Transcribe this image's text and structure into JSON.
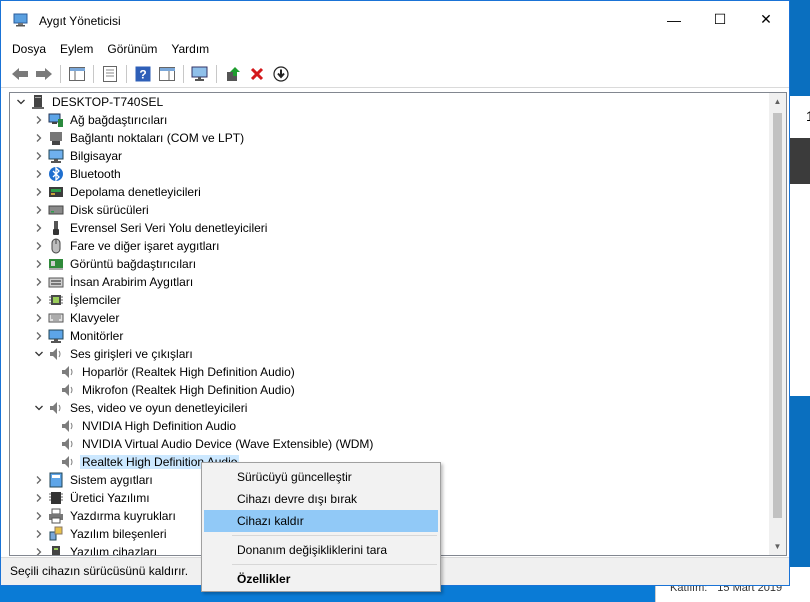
{
  "window": {
    "title": "Aygıt Yöneticisi",
    "minimize": "—",
    "maximize": "☐",
    "close": "✕"
  },
  "menu": [
    "Dosya",
    "Eylem",
    "Görünüm",
    "Yardım"
  ],
  "tree": {
    "root": "DESKTOP-T740SEL",
    "items": [
      {
        "label": "Ağ bağdaştırıcıları",
        "icon": "network-icon",
        "expanded": false,
        "level": 1
      },
      {
        "label": "Bağlantı noktaları (COM ve LPT)",
        "icon": "port-icon",
        "expanded": false,
        "level": 1
      },
      {
        "label": "Bilgisayar",
        "icon": "computer-icon",
        "expanded": false,
        "level": 1
      },
      {
        "label": "Bluetooth",
        "icon": "bluetooth-icon",
        "expanded": false,
        "level": 1
      },
      {
        "label": "Depolama denetleyicileri",
        "icon": "storage-icon",
        "expanded": false,
        "level": 1
      },
      {
        "label": "Disk sürücüleri",
        "icon": "disk-icon",
        "expanded": false,
        "level": 1
      },
      {
        "label": "Evrensel Seri Veri Yolu denetleyicileri",
        "icon": "usb-icon",
        "expanded": false,
        "level": 1
      },
      {
        "label": "Fare ve diğer işaret aygıtları",
        "icon": "mouse-icon",
        "expanded": false,
        "level": 1
      },
      {
        "label": "Görüntü bağdaştırıcıları",
        "icon": "display-adapter-icon",
        "expanded": false,
        "level": 1
      },
      {
        "label": "İnsan Arabirim Aygıtları",
        "icon": "hid-icon",
        "expanded": false,
        "level": 1
      },
      {
        "label": "İşlemciler",
        "icon": "cpu-icon",
        "expanded": false,
        "level": 1
      },
      {
        "label": "Klavyeler",
        "icon": "keyboard-icon",
        "expanded": false,
        "level": 1
      },
      {
        "label": "Monitörler",
        "icon": "monitor-icon",
        "expanded": false,
        "level": 1
      },
      {
        "label": "Ses girişleri ve çıkışları",
        "icon": "speaker-icon",
        "expanded": true,
        "level": 1
      },
      {
        "label": "Hoparlör (Realtek High Definition Audio)",
        "icon": "speaker-icon",
        "level": 2
      },
      {
        "label": "Mikrofon (Realtek High Definition Audio)",
        "icon": "speaker-icon",
        "level": 2
      },
      {
        "label": "Ses, video ve oyun denetleyicileri",
        "icon": "speaker-icon",
        "expanded": true,
        "level": 1
      },
      {
        "label": "NVIDIA High Definition Audio",
        "icon": "speaker-icon",
        "level": 2
      },
      {
        "label": "NVIDIA Virtual Audio Device (Wave Extensible) (WDM)",
        "icon": "speaker-icon",
        "level": 2
      },
      {
        "label": "Realtek High Definition Audio",
        "icon": "speaker-icon",
        "level": 2,
        "selected": true
      },
      {
        "label": "Sistem aygıtları",
        "icon": "system-icon",
        "expanded": false,
        "level": 1
      },
      {
        "label": "Üretici Yazılımı",
        "icon": "firmware-icon",
        "expanded": false,
        "level": 1
      },
      {
        "label": "Yazdırma kuyrukları",
        "icon": "printer-icon",
        "expanded": false,
        "level": 1
      },
      {
        "label": "Yazılım bileşenleri",
        "icon": "software-component-icon",
        "expanded": false,
        "level": 1
      },
      {
        "label": "Yazılım cihazları",
        "icon": "software-device-icon",
        "expanded": false,
        "level": 1
      }
    ]
  },
  "context_menu": {
    "items": [
      {
        "label": "Sürücüyü güncelleştir"
      },
      {
        "label": "Cihazı devre dışı bırak"
      },
      {
        "label": "Cihazı kaldır",
        "highlighted": true
      },
      {
        "label": "Donanım değişikliklerini tara"
      },
      {
        "label": "Özellikler",
        "bold": true
      }
    ]
  },
  "status": "Seçili cihazın sürücüsünü kaldırır.",
  "background": {
    "partial_text": "1",
    "info_label": "Katılım:",
    "info_value": "15 Mart 2019"
  },
  "colors": {
    "selection": "#cce8ff",
    "menu_highlight": "#91c9f7",
    "desktop": "#0a7bd6"
  }
}
